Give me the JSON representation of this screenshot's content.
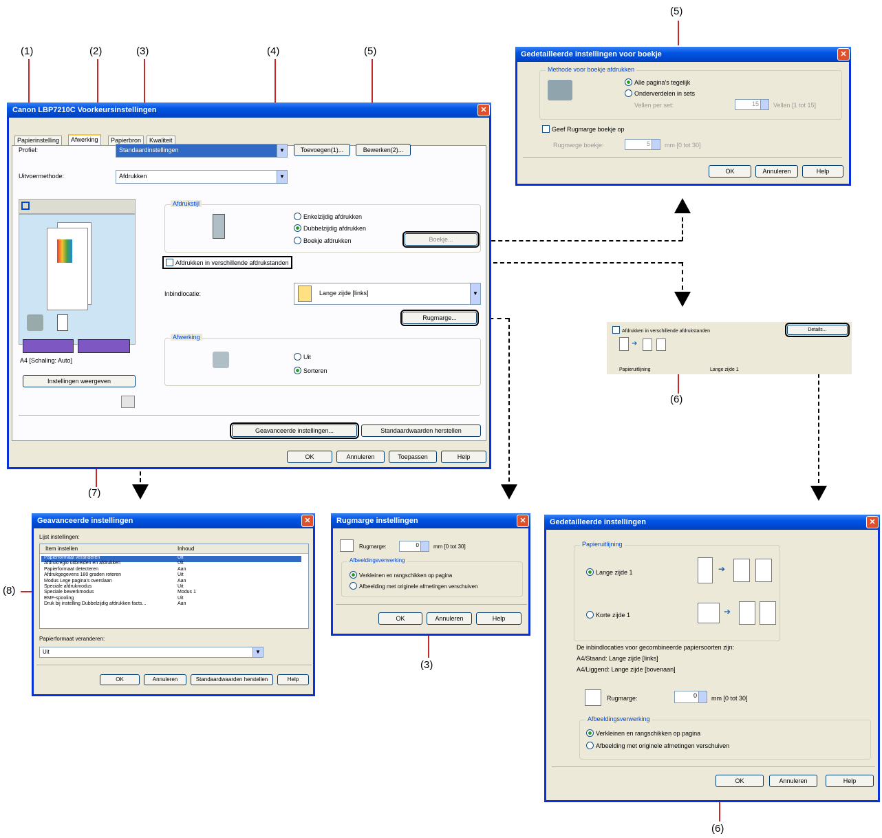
{
  "labels": {
    "n1": "(1)",
    "n2": "(2)",
    "n3": "(3)",
    "n4": "(4)",
    "n5": "(5)",
    "n5b": "(5)",
    "n6a": "(6)",
    "n6b": "(6)",
    "n7": "(7)",
    "n8": "(8)",
    "n3b": "(3)"
  },
  "main": {
    "title": "Canon LBP7210C Voorkeursinstellingen",
    "tabs": [
      "Papierinstelling",
      "Afwerking",
      "Papierbron",
      "Kwaliteit"
    ],
    "profile_label": "Profiel:",
    "profile_value": "Standaardinstellingen",
    "add_btn": "Toevoegen(1)...",
    "edit_btn": "Bewerken(2)...",
    "output_label": "Uitvoermethode:",
    "output_value": "Afdrukken",
    "print_group": "Afdrukstijl",
    "r_single": "Enkelzijdig afdrukken",
    "r_double": "Dubbelzijdig afdrukken",
    "r_booklet": "Boekje afdrukken",
    "booklet_btn": "Boekje...",
    "mixed_check": "Afdrukken in verschillende afdrukstanden",
    "binding_label": "Inbindlocatie:",
    "binding_value": "Lange zijde [links]",
    "gutter_btn": "Rugmarge...",
    "finish_group": "Afwerking",
    "r_off": "Uit",
    "r_collate": "Sorteren",
    "paper_info": "A4 [Schaling: Auto]",
    "show_settings_btn": "Instellingen weergeven",
    "advanced_btn": "Geavanceerde instellingen...",
    "restore_btn": "Standaardwaarden herstellen",
    "ok": "OK",
    "cancel": "Annuleren",
    "apply": "Toepassen",
    "help": "Help"
  },
  "booklet": {
    "title": "Gedetailleerde instellingen voor boekje",
    "group": "Methode voor boekje afdrukken",
    "r_all": "Alle pagina's tegelijk",
    "r_sets": "Onderverdelen in sets",
    "sheets_label": "Vellen per set:",
    "sheets_value": "15",
    "sheets_range": "Vellen [1 tot 15]",
    "gutter_check": "Geef Rugmarge boekje op",
    "gutter_label": "Rugmarge boekje:",
    "gutter_value": "5",
    "gutter_range": "mm [0 tot 30]",
    "ok": "OK",
    "cancel": "Annuleren",
    "help": "Help"
  },
  "mixed": {
    "check": "Afdrukken in verschillende afdrukstanden",
    "btn": "Details...",
    "col1": "Papieruitlijning",
    "col2": "Lange zijde 1"
  },
  "advanced": {
    "title": "Geavanceerde instellingen",
    "list_label": "Lijst instellingen:",
    "col1": "Item instellen",
    "col2": "Inhoud",
    "rows": [
      [
        "Papierformaat veranderen",
        "Uit"
      ],
      [
        "Afdrukregio uitbreiden en afdrukken",
        "Uit"
      ],
      [
        "Papierformaat detecteren",
        "Aan"
      ],
      [
        "Afdrukgegevens 180 graden roteren",
        "Uit"
      ],
      [
        "Modus Lege pagina's overslaan",
        "Aan"
      ],
      [
        "Speciale afdrukmodus",
        "Uit"
      ],
      [
        "Speciale bewerkmodus",
        "Modus 1"
      ],
      [
        "EMF-spooling",
        "Uit"
      ],
      [
        "Druk bij instelling Dubbelzijdig afdrukken facts...",
        "Aan"
      ]
    ],
    "change_label": "Papierformaat veranderen:",
    "change_value": "Uit",
    "ok": "OK",
    "cancel": "Annuleren",
    "restore": "Standaardwaarden herstellen",
    "help": "Help"
  },
  "gutter": {
    "title": "Rugmarge instellingen",
    "label": "Rugmarge:",
    "value": "0",
    "range": "mm [0 tot 30]",
    "group": "Afbeeldingsverwerking",
    "r_shrink": "Verkleinen en rangschikken op pagina",
    "r_shift": "Afbeelding met originele afmetingen verschuiven",
    "ok": "OK",
    "cancel": "Annuleren",
    "help": "Help"
  },
  "detail": {
    "title": "Gedetailleerde instellingen",
    "group": "Papieruitlijning",
    "r_long": "Lange zijde 1",
    "r_short": "Korte zijde 1",
    "info1": "De inbindlocaties voor gecombineerde papiersoorten zijn:",
    "info2": "A4/Staand: Lange zijde [links]",
    "info3": "A4/Liggend: Lange zijde [bovenaan]",
    "gutter_label": "Rugmarge:",
    "gutter_value": "0",
    "gutter_range": "mm [0 tot 30]",
    "img_group": "Afbeeldingsverwerking",
    "r_shrink": "Verkleinen en rangschikken op pagina",
    "r_shift": "Afbeelding met originele afmetingen verschuiven",
    "ok": "OK",
    "cancel": "Annuleren",
    "help": "Help"
  }
}
